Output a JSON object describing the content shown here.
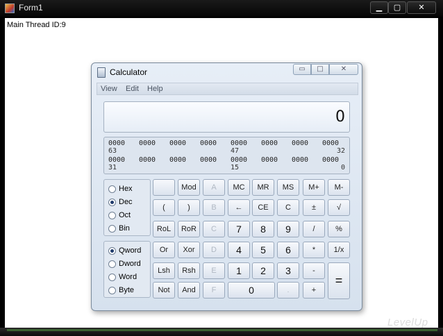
{
  "form1": {
    "title": "Form1",
    "buttons": {
      "minimize": "▁",
      "maximize": "▢",
      "close": "✕"
    },
    "label": "Main Thread ID:9",
    "watermark": "LevelUp"
  },
  "calculator": {
    "title": "Calculator",
    "window_buttons": {
      "minimize": "▭",
      "maximize": "□",
      "close": "✕"
    },
    "menu": [
      "View",
      "Edit",
      "Help"
    ],
    "display": "0",
    "binary": {
      "row1": [
        "0000",
        "0000",
        "0000",
        "0000",
        "0000",
        "0000",
        "0000",
        "0000"
      ],
      "row1_pos": [
        "63",
        "47",
        "32"
      ],
      "row2": [
        "0000",
        "0000",
        "0000",
        "0000",
        "0000",
        "0000",
        "0000",
        "0000"
      ],
      "row2_pos": [
        "31",
        "15",
        "0"
      ]
    },
    "radix": [
      {
        "label": "Hex",
        "selected": false
      },
      {
        "label": "Dec",
        "selected": true
      },
      {
        "label": "Oct",
        "selected": false
      },
      {
        "label": "Bin",
        "selected": false
      }
    ],
    "word_size": [
      {
        "label": "Qword",
        "selected": true
      },
      {
        "label": "Dword",
        "selected": false
      },
      {
        "label": "Word",
        "selected": false
      },
      {
        "label": "Byte",
        "selected": false
      }
    ],
    "keys": {
      "r1": [
        "",
        "Mod",
        "A",
        "MC",
        "MR",
        "MS",
        "M+",
        "M-"
      ],
      "r2": [
        "(",
        ")",
        "B",
        "←",
        "CE",
        "C",
        "±",
        "√"
      ],
      "r3": [
        "RoL",
        "RoR",
        "C",
        "7",
        "8",
        "9",
        "/",
        "%"
      ],
      "r4": [
        "Or",
        "Xor",
        "D",
        "4",
        "5",
        "6",
        "*",
        "1/x"
      ],
      "r5": [
        "Lsh",
        "Rsh",
        "E",
        "1",
        "2",
        "3",
        "-",
        "="
      ],
      "r6": [
        "Not",
        "And",
        "F",
        "0",
        ".",
        "+"
      ]
    }
  }
}
